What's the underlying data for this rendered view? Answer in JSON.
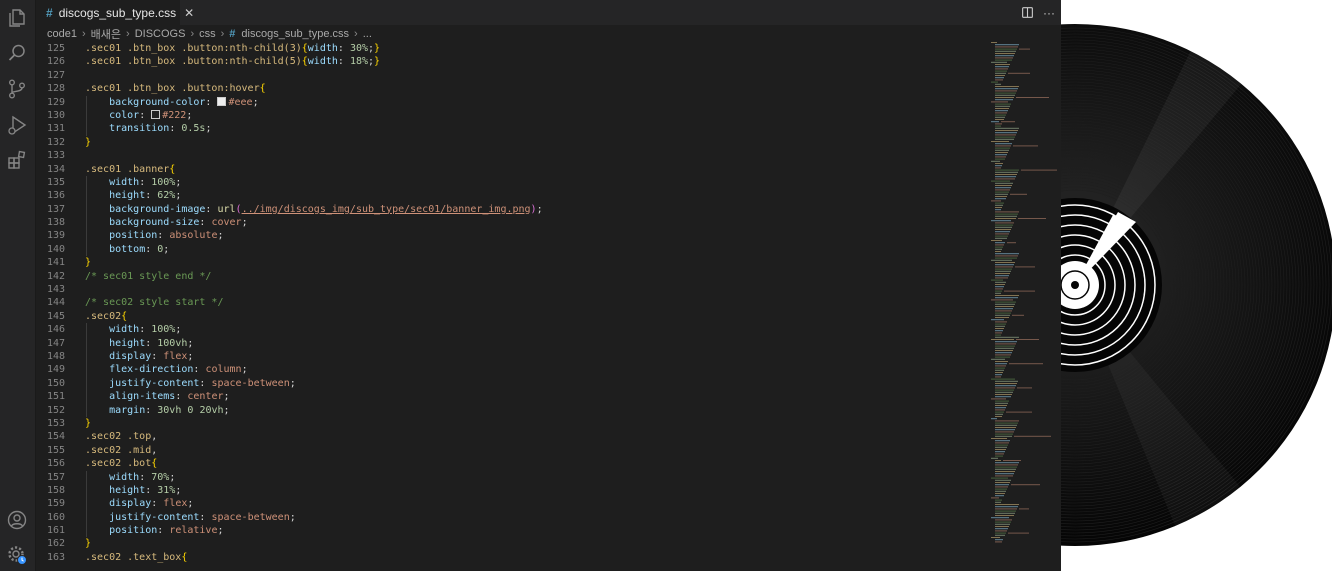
{
  "editor": {
    "tab": {
      "icon": "#",
      "title": "discogs_sub_type.css",
      "close": "✕"
    },
    "breadcrumb": {
      "items": [
        "code1",
        "배새은",
        "DISCOGS",
        "css"
      ],
      "file_icon": "#",
      "file": "discogs_sub_type.css",
      "ellipsis": "..."
    },
    "actions": {
      "more": "···"
    },
    "colors": {
      "background": "#1e1e1e",
      "activity_bar": "#252526",
      "selector": "#d7ba7d",
      "property": "#9cdcfe",
      "value": "#ce9178",
      "number": "#b5cea8",
      "comment": "#6a9955",
      "brace": "#ffd700"
    },
    "icons": [
      "files-icon",
      "search-icon",
      "source-control-icon",
      "run-debug-icon",
      "extensions-icon",
      "account-icon",
      "settings-gear-icon",
      "split-editor-icon",
      "more-actions-icon",
      "close-icon"
    ]
  },
  "code_lines": [
    {
      "n": 125,
      "text": ".sec01 .btn_box .button:nth-child(3){width: 30%;}"
    },
    {
      "n": 126,
      "text": ".sec01 .btn_box .button:nth-child(5){width: 18%;}"
    },
    {
      "n": 127,
      "text": ""
    },
    {
      "n": 128,
      "text": ".sec01 .btn_box .button:hover{"
    },
    {
      "n": 129,
      "text": "    background-color: #eee;"
    },
    {
      "n": 130,
      "text": "    color: #222;"
    },
    {
      "n": 131,
      "text": "    transition: 0.5s;"
    },
    {
      "n": 132,
      "text": "}"
    },
    {
      "n": 133,
      "text": ""
    },
    {
      "n": 134,
      "text": ".sec01 .banner{"
    },
    {
      "n": 135,
      "text": "    width: 100%;"
    },
    {
      "n": 136,
      "text": "    height: 62%;"
    },
    {
      "n": 137,
      "text": "    background-image: url(../img/discogs_img/sub_type/sec01/banner_img.png);"
    },
    {
      "n": 138,
      "text": "    background-size: cover;"
    },
    {
      "n": 139,
      "text": "    position: absolute;"
    },
    {
      "n": 140,
      "text": "    bottom: 0;"
    },
    {
      "n": 141,
      "text": "}"
    },
    {
      "n": 142,
      "text": "/* sec01 style end */"
    },
    {
      "n": 143,
      "text": ""
    },
    {
      "n": 144,
      "text": "/* sec02 style start */"
    },
    {
      "n": 145,
      "text": ".sec02{"
    },
    {
      "n": 146,
      "text": "    width: 100%;"
    },
    {
      "n": 147,
      "text": "    height: 100vh;"
    },
    {
      "n": 148,
      "text": "    display: flex;"
    },
    {
      "n": 149,
      "text": "    flex-direction: column;"
    },
    {
      "n": 150,
      "text": "    justify-content: space-between;"
    },
    {
      "n": 151,
      "text": "    align-items: center;"
    },
    {
      "n": 152,
      "text": "    margin: 30vh 0 20vh;"
    },
    {
      "n": 153,
      "text": "}"
    },
    {
      "n": 154,
      "text": ".sec02 .top,"
    },
    {
      "n": 155,
      "text": ".sec02 .mid,"
    },
    {
      "n": 156,
      "text": ".sec02 .bot{"
    },
    {
      "n": 157,
      "text": "    width: 70%;"
    },
    {
      "n": 158,
      "text": "    height: 31%;"
    },
    {
      "n": 159,
      "text": "    display: flex;"
    },
    {
      "n": 160,
      "text": "    justify-content: space-between;"
    },
    {
      "n": 161,
      "text": "    position: relative;"
    },
    {
      "n": 162,
      "text": "}"
    },
    {
      "n": 163,
      "text": ".sec02 .text_box{"
    }
  ]
}
